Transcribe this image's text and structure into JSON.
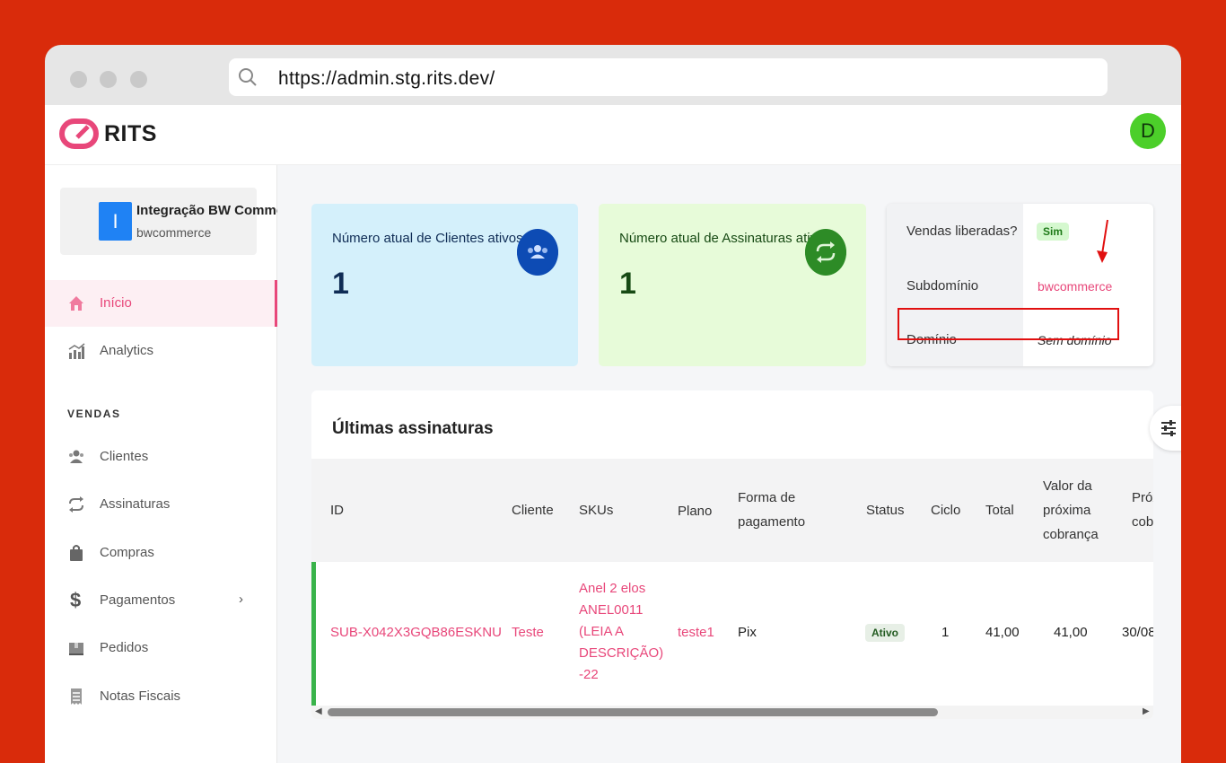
{
  "browser": {
    "url": "https://admin.stg.rits.dev/"
  },
  "app": {
    "logo_text": "RITS",
    "avatar_initial": "D"
  },
  "sidebar": {
    "store": {
      "initial": "I",
      "name": "Integração BW Commerce",
      "subdomain": "bwcommerce"
    },
    "items": [
      {
        "label": "Início",
        "icon": "home-icon",
        "active": true
      },
      {
        "label": "Analytics",
        "icon": "analytics-icon"
      }
    ],
    "section_vendas": "VENDAS",
    "vendas_items": [
      {
        "label": "Clientes",
        "icon": "users-icon"
      },
      {
        "label": "Assinaturas",
        "icon": "repeat-icon"
      },
      {
        "label": "Compras",
        "icon": "bag-icon"
      },
      {
        "label": "Pagamentos",
        "icon": "dollar-icon",
        "chevron": "›"
      },
      {
        "label": "Pedidos",
        "icon": "box-icon"
      },
      {
        "label": "Notas Fiscais",
        "icon": "receipt-icon"
      }
    ]
  },
  "dashboard": {
    "clients_card": {
      "title": "Número atual de Clientes ativos",
      "value": "1"
    },
    "subs_card": {
      "title": "Número atual de Assinaturas ativas",
      "value": "1"
    },
    "info": {
      "vendas_label": "Vendas liberadas?",
      "vendas_value": "Sim",
      "subdominio_label": "Subdomínio",
      "subdominio_value": "bwcommerce",
      "dominio_label": "Domínio",
      "dominio_value": "Sem domínio"
    }
  },
  "table": {
    "title": "Últimas assinaturas",
    "headers": {
      "id": "ID",
      "cliente": "Cliente",
      "skus": "SKUs",
      "plano": "Plano",
      "forma_1": "Forma de",
      "forma_2": "pagamento",
      "status": "Status",
      "ciclo": "Ciclo",
      "total": "Total",
      "valor_1": "Valor da",
      "valor_2": "próxima",
      "valor_3": "cobrança",
      "prox_1": "Próx",
      "prox_2": "cobr"
    },
    "row": {
      "id": "SUB-X042X3GQB86ESKNU",
      "cliente": "Teste",
      "sku_1": "Anel 2 elos",
      "sku_2": "ANEL0011",
      "sku_3": "(LEIA A",
      "sku_4": "DESCRIÇÃO)",
      "sku_5": "-22",
      "plano": "teste1",
      "forma": "Pix",
      "status": "Ativo",
      "ciclo": "1",
      "total": "41,00",
      "valor": "41,00",
      "prox": "30/08"
    }
  },
  "colors": {
    "brand": "#e8477a",
    "background": "#d92b0b",
    "highlight": "#e11010"
  }
}
